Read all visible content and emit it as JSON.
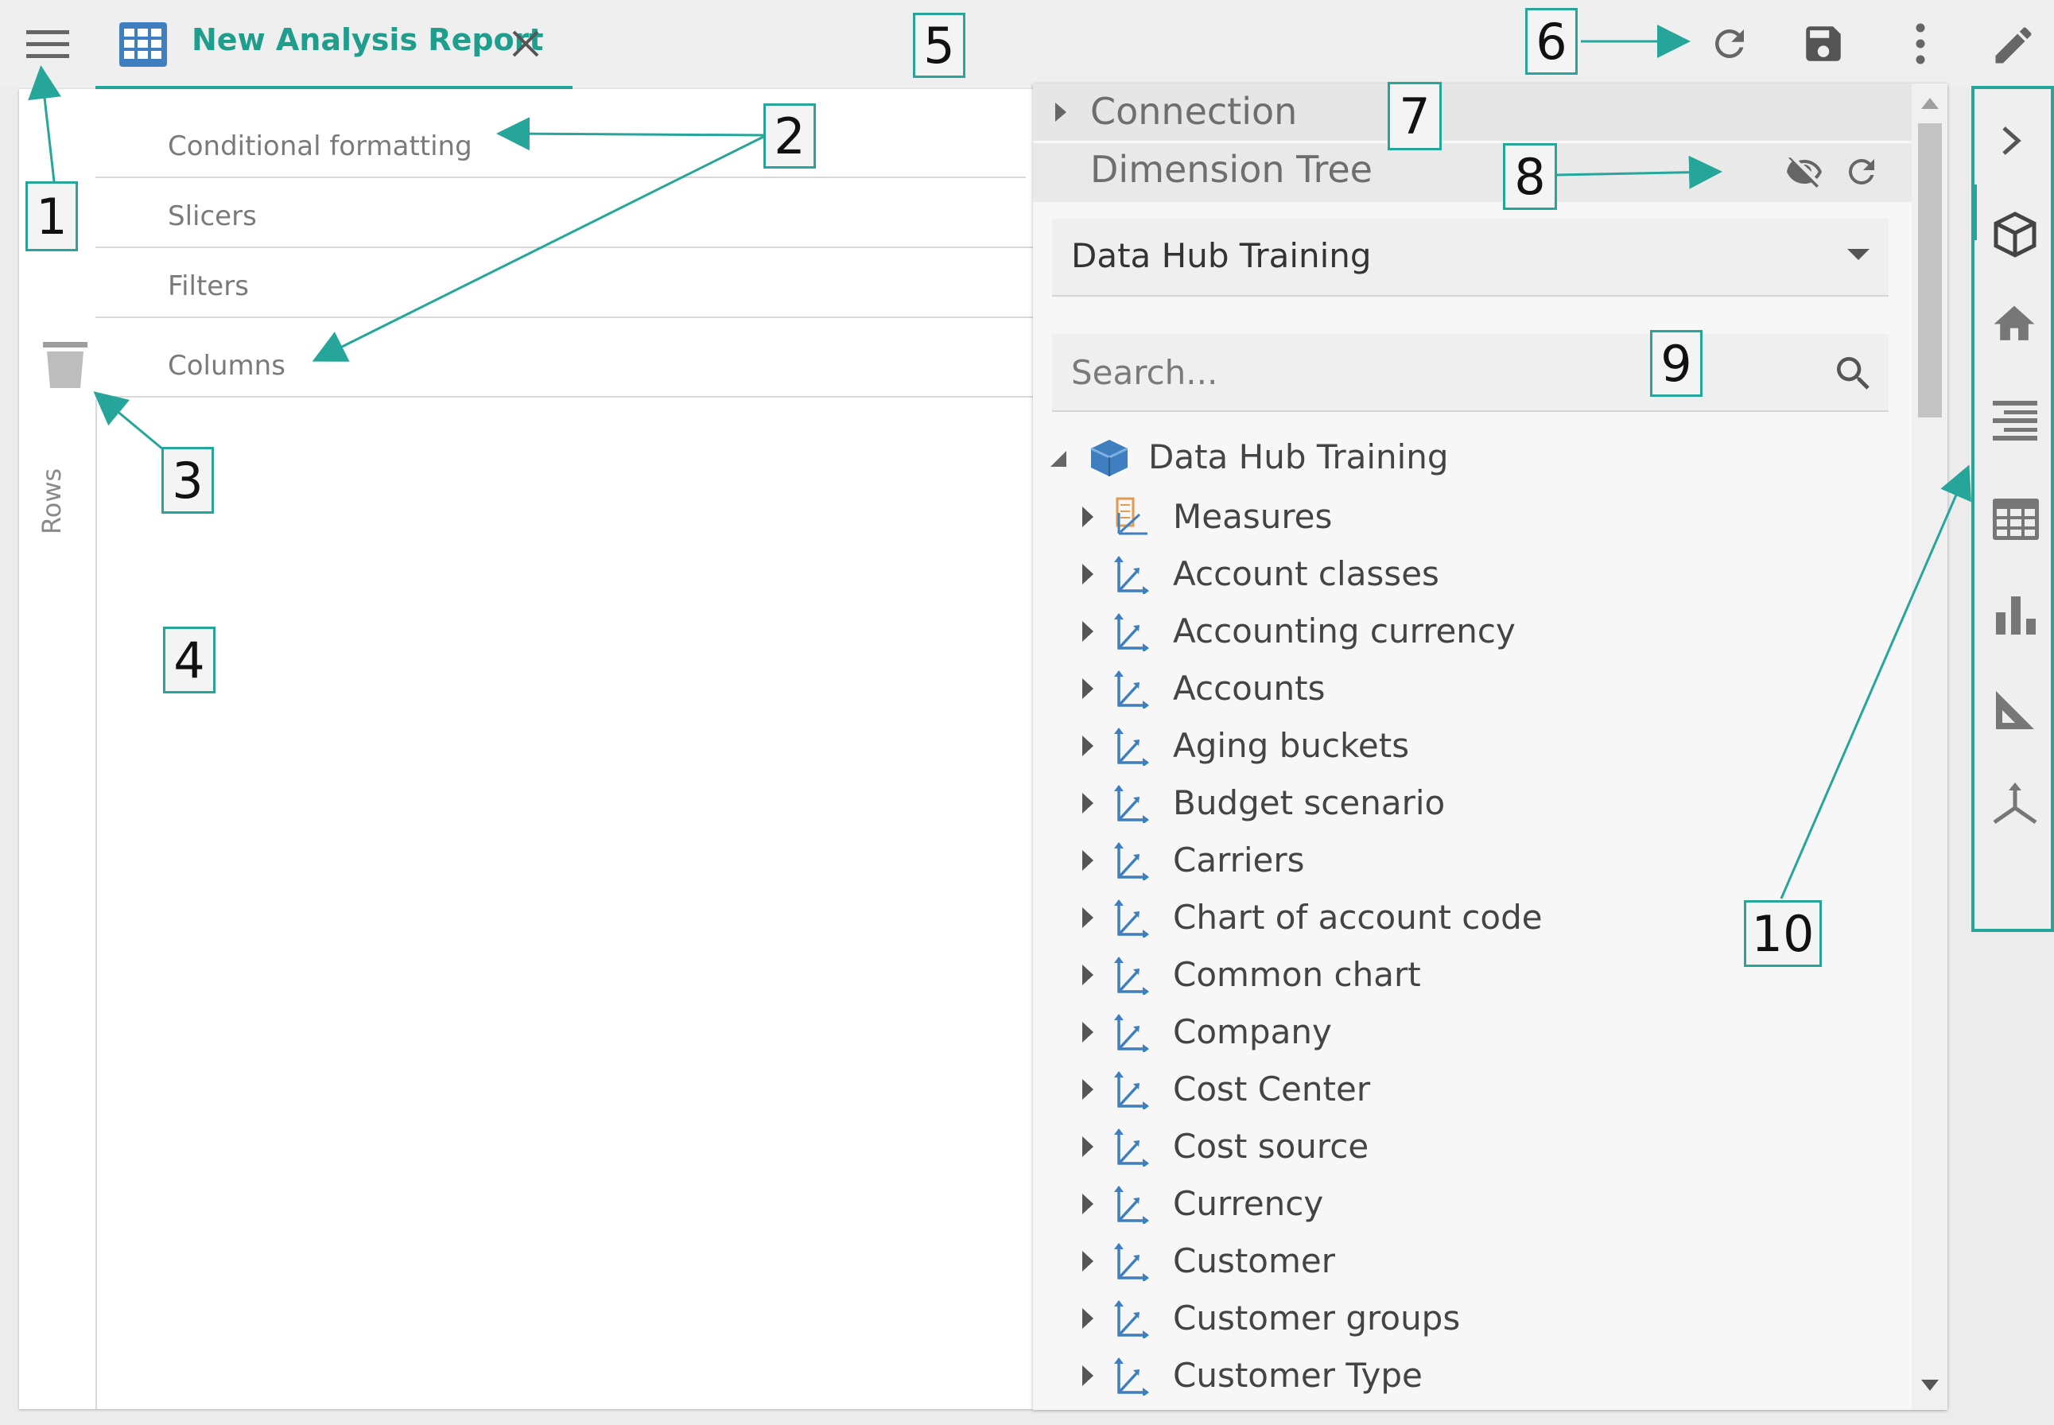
{
  "header": {
    "menu_icon": "hamburger-menu-icon",
    "tab_icon": "grid-table-icon",
    "tab_title": "New Analysis Report",
    "close_icon": "close-icon",
    "actions": [
      "refresh-icon",
      "save-icon",
      "more-vertical-icon",
      "edit-pencil-icon"
    ]
  },
  "left_panel": {
    "zones": [
      "Conditional formatting",
      "Slicers",
      "Filters",
      "Columns"
    ],
    "rows_label": "Rows",
    "trash_icon": "trash-icon"
  },
  "right_panel": {
    "connection_title": "Connection",
    "dimension_tree_title": "Dimension Tree",
    "hide_icon": "eye-off-icon",
    "refresh_icon": "refresh-icon",
    "cube_select": "Data Hub Training",
    "search_placeholder": "Search...",
    "tree_root": "Data Hub Training",
    "tree_items": [
      {
        "label": "Measures",
        "icon": "measures-icon"
      },
      {
        "label": "Account classes",
        "icon": "dimension-icon"
      },
      {
        "label": "Accounting currency",
        "icon": "dimension-icon"
      },
      {
        "label": "Accounts",
        "icon": "dimension-icon"
      },
      {
        "label": "Aging buckets",
        "icon": "dimension-icon"
      },
      {
        "label": "Budget scenario",
        "icon": "dimension-icon"
      },
      {
        "label": "Carriers",
        "icon": "dimension-icon"
      },
      {
        "label": "Chart of account code",
        "icon": "dimension-icon"
      },
      {
        "label": "Common chart",
        "icon": "dimension-icon"
      },
      {
        "label": "Company",
        "icon": "dimension-icon"
      },
      {
        "label": "Cost Center",
        "icon": "dimension-icon"
      },
      {
        "label": "Cost source",
        "icon": "dimension-icon"
      },
      {
        "label": "Currency",
        "icon": "dimension-icon"
      },
      {
        "label": "Customer",
        "icon": "dimension-icon"
      },
      {
        "label": "Customer groups",
        "icon": "dimension-icon"
      },
      {
        "label": "Customer Type",
        "icon": "dimension-icon"
      }
    ]
  },
  "sidebar": {
    "items": [
      "chevron-right-icon",
      "cube-icon",
      "home-icon",
      "list-icon",
      "table-icon",
      "bar-chart-icon",
      "ruler-icon",
      "axes-3d-icon"
    ]
  },
  "callouts": [
    "1",
    "2",
    "3",
    "4",
    "5",
    "6",
    "7",
    "8",
    "9",
    "10"
  ],
  "colors": {
    "accent": "#26a69a",
    "tab_text": "#1f9e8d",
    "dimension_icon": "#3f7fc0",
    "cube": "#3f7fc0"
  }
}
